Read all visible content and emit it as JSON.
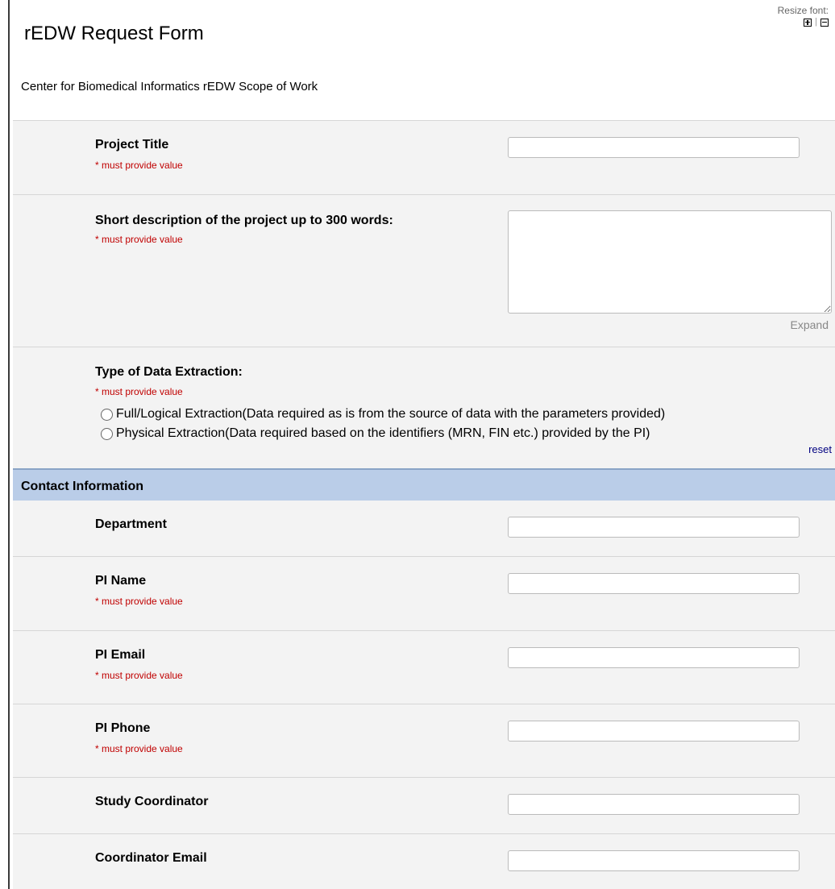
{
  "page": {
    "title": "rEDW Request Form",
    "subtitle": "Center for Biomedical Informatics rEDW Scope of Work"
  },
  "resize_font": {
    "label": "Resize font:",
    "increase_icon": "plus-square-icon",
    "separator": "|",
    "decrease_icon": "minus-square-icon"
  },
  "required_text": "* must provide value",
  "fields": {
    "project_title": {
      "label": "Project Title",
      "value": ""
    },
    "short_description": {
      "label": "Short description of the project up to 300 words:",
      "value": "",
      "expand_label": "Expand"
    },
    "extraction_type": {
      "label": "Type of Data Extraction:",
      "options": [
        "Full/Logical Extraction(Data required as is from the source of data with the parameters provided)",
        "Physical Extraction(Data required based on the identifiers (MRN, FIN etc.) provided by the PI)"
      ],
      "selected": null,
      "reset_label": "reset"
    },
    "department": {
      "label": "Department",
      "value": ""
    },
    "pi_name": {
      "label": "PI Name",
      "value": ""
    },
    "pi_email": {
      "label": "PI Email",
      "value": ""
    },
    "pi_phone": {
      "label": "PI Phone",
      "value": ""
    },
    "study_coordinator": {
      "label": "Study Coordinator",
      "value": ""
    },
    "coordinator_email": {
      "label": "Coordinator Email",
      "value": ""
    }
  },
  "sections": {
    "contact_information": "Contact Information"
  },
  "colors": {
    "row_background": "#f3f3f3",
    "section_header": "#bacde8",
    "required_red": "#c00000",
    "link_navy": "#000080"
  }
}
